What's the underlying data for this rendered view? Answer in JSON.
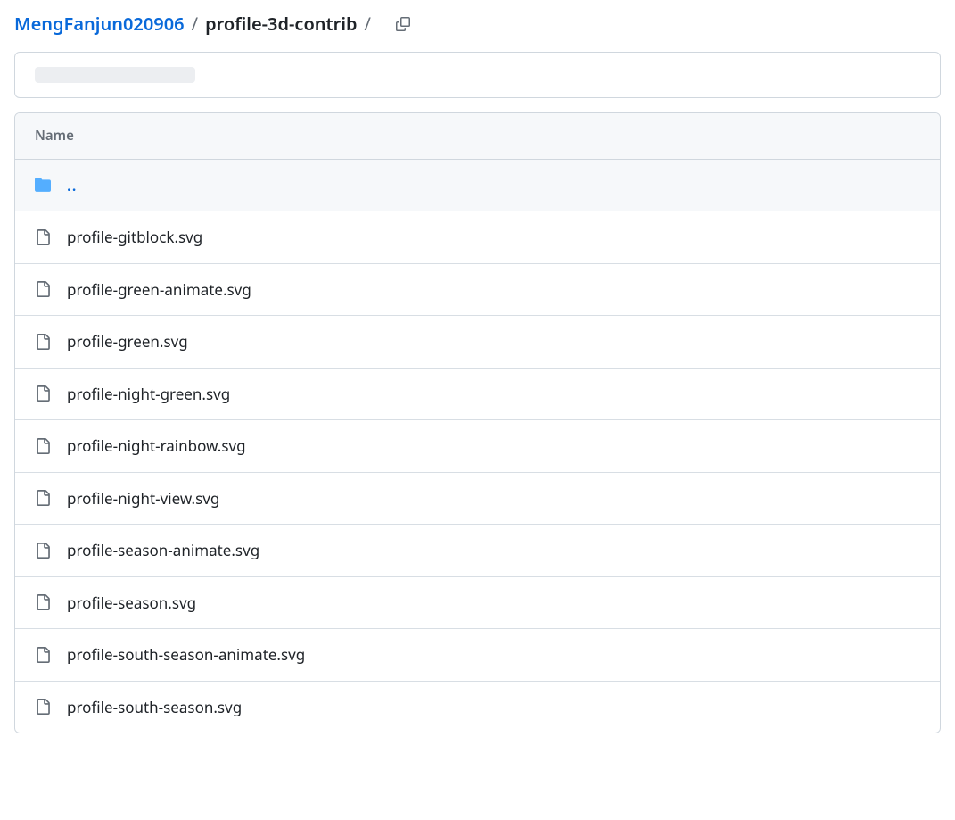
{
  "breadcrumb": {
    "owner": "MengFanjun020906",
    "sep": "/",
    "repo": "profile-3d-contrib",
    "trailing_sep": "/"
  },
  "header": {
    "name_label": "Name"
  },
  "files": {
    "parent_label": "..",
    "items": [
      {
        "name": "profile-gitblock.svg"
      },
      {
        "name": "profile-green-animate.svg"
      },
      {
        "name": "profile-green.svg"
      },
      {
        "name": "profile-night-green.svg"
      },
      {
        "name": "profile-night-rainbow.svg"
      },
      {
        "name": "profile-night-view.svg"
      },
      {
        "name": "profile-season-animate.svg"
      },
      {
        "name": "profile-season.svg"
      },
      {
        "name": "profile-south-season-animate.svg"
      },
      {
        "name": "profile-south-season.svg"
      }
    ]
  }
}
